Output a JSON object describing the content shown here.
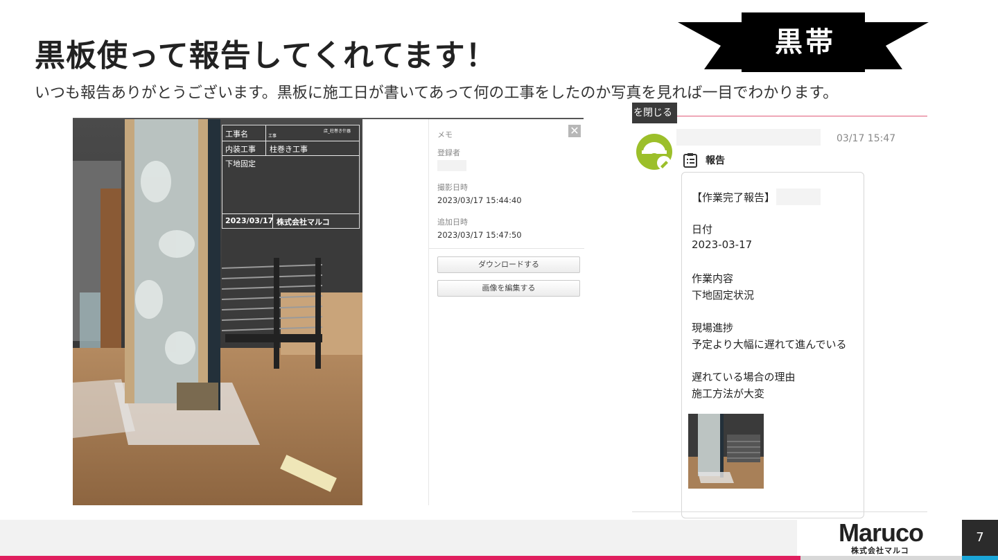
{
  "slide": {
    "title": "黒板使って報告してくれてます！",
    "subtitle": "いつも報告ありがとうございます。黒板に施工日が書いてあって何の工事をしたのか写真を見れば一目でわかります。",
    "ribbon": "黒帯",
    "page_number": "7"
  },
  "photo_viewer": {
    "blackboard": {
      "label_koji_name": "工事名",
      "koji_small": "工事",
      "koji_tag": "店_柱巻き什器",
      "row2_left": "内装工事",
      "row2_right": "柱巻き工事",
      "body": "下地固定",
      "date": "2023/03/17",
      "company": "株式会社マルコ"
    },
    "memo_label": "メモ",
    "registrant_label": "登録者",
    "shot_label": "撮影日時",
    "shot_value": "2023/03/17 15:44:40",
    "added_label": "追加日時",
    "added_value": "2023/03/17 15:47:50",
    "download_button": "ダウンロードする",
    "edit_button": "画像を編集する",
    "close_glyph": "✕"
  },
  "chat": {
    "close_label": "を閉じる",
    "time": "03/17 15:47",
    "report_label": "報告",
    "report_heading": "【作業完了報告】",
    "date_label": "日付",
    "date_value": "2023-03-17",
    "work_label": "作業内容",
    "work_value": "下地固定状況",
    "progress_label": "現場進捗",
    "progress_value": "予定より大幅に遅れて進んでいる",
    "reason_label": "遅れている場合の理由",
    "reason_value": "施工方法が大変"
  },
  "footer": {
    "logo": "Maruco",
    "company": "株式会社マルコ"
  },
  "colors": {
    "accent_red": "#e01f5e",
    "accent_blue": "#1aa6d8",
    "ribbon": "#000000"
  }
}
